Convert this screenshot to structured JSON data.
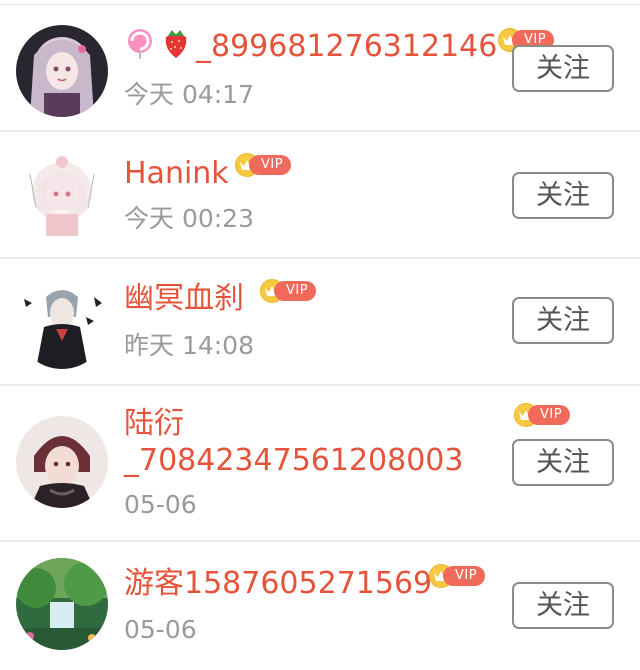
{
  "users": [
    {
      "name": "_899681276312146",
      "name_prefix_emojis": [
        "lollipop-icon",
        "strawberry-icon"
      ],
      "time": "今天 04:17",
      "vip": true,
      "vip_label": "VIP",
      "follow_label": "关注"
    },
    {
      "name": "Hanink",
      "time": "今天 00:23",
      "vip": true,
      "vip_label": "VIP",
      "follow_label": "关注"
    },
    {
      "name": "幽冥血刹",
      "time": "昨天 14:08",
      "vip": true,
      "vip_label": "VIP",
      "follow_label": "关注"
    },
    {
      "name_line1": "陆衍",
      "name_line2": "_70842347561208003",
      "time": "05-06",
      "vip": true,
      "vip_label": "VIP",
      "follow_label": "关注"
    },
    {
      "name": "游客1587605271569",
      "time": "05-06",
      "vip": true,
      "vip_label": "VIP",
      "follow_label": "关注"
    }
  ],
  "colors": {
    "name": "#e5533b",
    "time": "#9a9a9a",
    "vip_pill": "#f06a5b",
    "crown": "#f7c842",
    "button_border": "#8c8c8c",
    "divider": "#ececec"
  }
}
